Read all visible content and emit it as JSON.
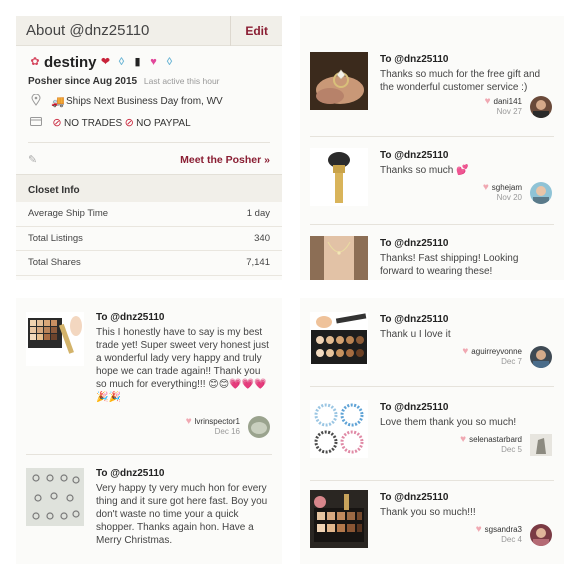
{
  "about": {
    "title": "About @dnz25110",
    "edit_label": "Edit",
    "username": "destiny",
    "posher_since": "Posher since Aug 2015",
    "last_active": "Last active this hour",
    "shipping": "Ships Next Business Day from, WV",
    "trades": "NO TRADES",
    "paypal": "NO PAYPAL",
    "meet_label": "Meet the Posher »"
  },
  "closet": {
    "header": "Closet Info",
    "rows": [
      {
        "label": "Average Ship Time",
        "value": "1 day"
      },
      {
        "label": "Total Listings",
        "value": "340"
      },
      {
        "label": "Total Shares",
        "value": "7,141"
      }
    ]
  },
  "reviews": [
    {
      "to": "To @dnz25110",
      "text": "Thanks so much for the free gift and the wonderful customer service :)",
      "user": "dani141",
      "date": "Nov 27"
    },
    {
      "to": "To @dnz25110",
      "text": "Thanks so much 💕",
      "user": "sghejam",
      "date": "Nov 20"
    },
    {
      "to": "To @dnz25110",
      "text": "Thanks! Fast shipping! Looking forward to wearing these!",
      "user": "",
      "date": ""
    },
    {
      "to": "To @dnz25110",
      "text": "This I honestly have to say is my best trade yet! Super sweet very honest just a wonderful lady very happy and truly hope we can trade again!! Thank you so much for everything!!! 😊😊💗💗💗🎉🎉",
      "user": "lvrinspector1",
      "date": "Dec 16"
    },
    {
      "to": "To @dnz25110",
      "text": "Very happy ty very much hon for every thing and it sure got here fast. Boy you don't waste no time your a quick shopper. Thanks again hon. Have a Merry Christmas.",
      "user": "",
      "date": ""
    },
    {
      "to": "To @dnz25110",
      "text": "Thank u I love it",
      "user": "aguirreyvonne",
      "date": "Dec 7"
    },
    {
      "to": "To @dnz25110",
      "text": "Love them thank you so much!",
      "user": "selenastarbard",
      "date": "Dec 5"
    },
    {
      "to": "To @dnz25110",
      "text": "Thank you so much!!!",
      "user": "sgsandra3",
      "date": "Dec 4"
    }
  ],
  "colors": {
    "accent": "#8a1e33",
    "panel": "#fbfbf9",
    "header": "#f1efe9"
  }
}
